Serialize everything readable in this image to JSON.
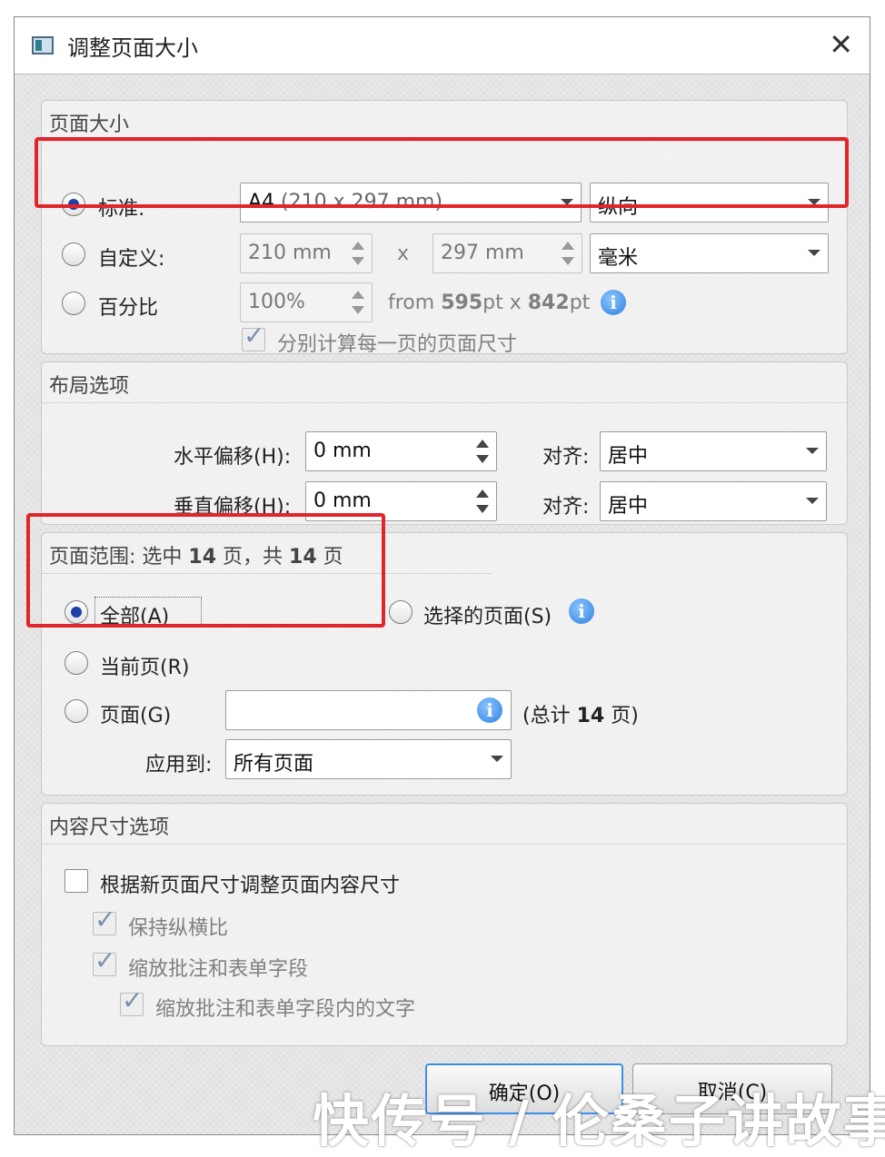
{
  "dialog": {
    "title": "调整页面大小",
    "close_glyph": "✕"
  },
  "page_size": {
    "group_title": "页面大小",
    "standard": {
      "label": "标准:",
      "size_value_main": "A4",
      "size_value_detail": "(210 x 297 mm)",
      "orientation": "纵向",
      "selected": true
    },
    "custom": {
      "label": "自定义:",
      "width": "210 mm",
      "times": "x",
      "height": "297 mm",
      "unit": "毫米"
    },
    "percent": {
      "label": "百分比",
      "value": "100%",
      "from_prefix": "from",
      "from_w": "595",
      "from_pt1": "pt x",
      "from_h": "842",
      "from_pt2": "pt"
    },
    "per_page_label": "分别计算每一页的页面尺寸",
    "per_page_checked": true
  },
  "layout": {
    "group_title": "布局选项",
    "h_offset_label": "水平偏移(H):",
    "h_offset_value": "0 mm",
    "h_align_label": "对齐:",
    "h_align_value": "居中",
    "v_offset_label": "垂直偏移(H):",
    "v_offset_value": "0 mm",
    "v_align_label": "对齐:",
    "v_align_value": "居中"
  },
  "page_range": {
    "title_prefix": "页面范围: 选中",
    "selected_count": "14",
    "title_mid": "页，共",
    "total_count": "14",
    "title_suffix": "页",
    "all_label": "全部(A)",
    "all_selected": true,
    "selected_pages_label": "选择的页面(S)",
    "current_page_label": "当前页(R)",
    "pages_label": "页面(G)",
    "pages_value": "",
    "total_prefix": "(总计",
    "total_suffix": "页)",
    "apply_to_label": "应用到:",
    "apply_to_value": "所有页面"
  },
  "content_size": {
    "group_title": "内容尺寸选项",
    "resize_content_label": "根据新页面尺寸调整页面内容尺寸",
    "resize_content_checked": false,
    "keep_ratio_label": "保持纵横比",
    "scale_fields_label": "缩放批注和表单字段",
    "scale_text_label": "缩放批注和表单字段内的文字"
  },
  "buttons": {
    "ok": "确定(O)",
    "cancel": "取消(C)"
  },
  "watermark": "快传号 / 伦桑子讲故事",
  "colors": {
    "highlight_box": "#e0252b",
    "radio_dot": "#1e3fa8",
    "info_icon": "#2b82e0",
    "default_button_border": "#3d8ee6"
  },
  "icons": [
    "app-icon",
    "close-icon",
    "info-icon",
    "dropdown-arrow-icon",
    "spinner-icon",
    "checkmark-icon"
  ]
}
